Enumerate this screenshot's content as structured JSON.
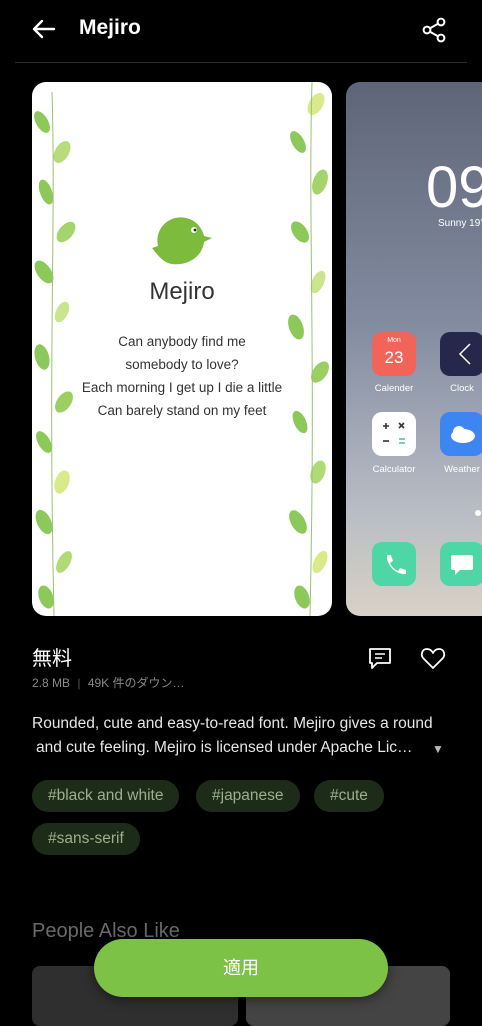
{
  "header": {
    "title": "Mejiro",
    "back_icon": "arrow-left-icon",
    "share_icon": "share-icon"
  },
  "preview": {
    "font_name": "Mejiro",
    "lyrics": [
      "Can anybody find me",
      "somebody to love?",
      "Each morning I get up I die a little",
      "Can barely stand on my feet"
    ],
    "home_screen": {
      "clock": "09",
      "weather": "Sunny 19°",
      "calendar_month": "Mon",
      "calendar_day": "23",
      "apps": [
        "Calender",
        "Clock",
        "Calculator",
        "Weather"
      ]
    }
  },
  "info": {
    "price": "無料",
    "size": "2.8 MB",
    "downloads": "49K 件のダウン…",
    "description_line1": "Rounded, cute and easy-to-read font. Mejiro gives a round",
    "description_line2": "and cute feeling. Mejiro is licensed under Apache Lic…"
  },
  "tags": [
    "#black and white",
    "#japanese",
    "#cute",
    "#sans-serif"
  ],
  "section_title": "People Also Like",
  "apply_label": "適用",
  "colors": {
    "accent": "#7cc247",
    "tag_bg": "#1c2c18",
    "tag_text": "#9ab08e"
  }
}
